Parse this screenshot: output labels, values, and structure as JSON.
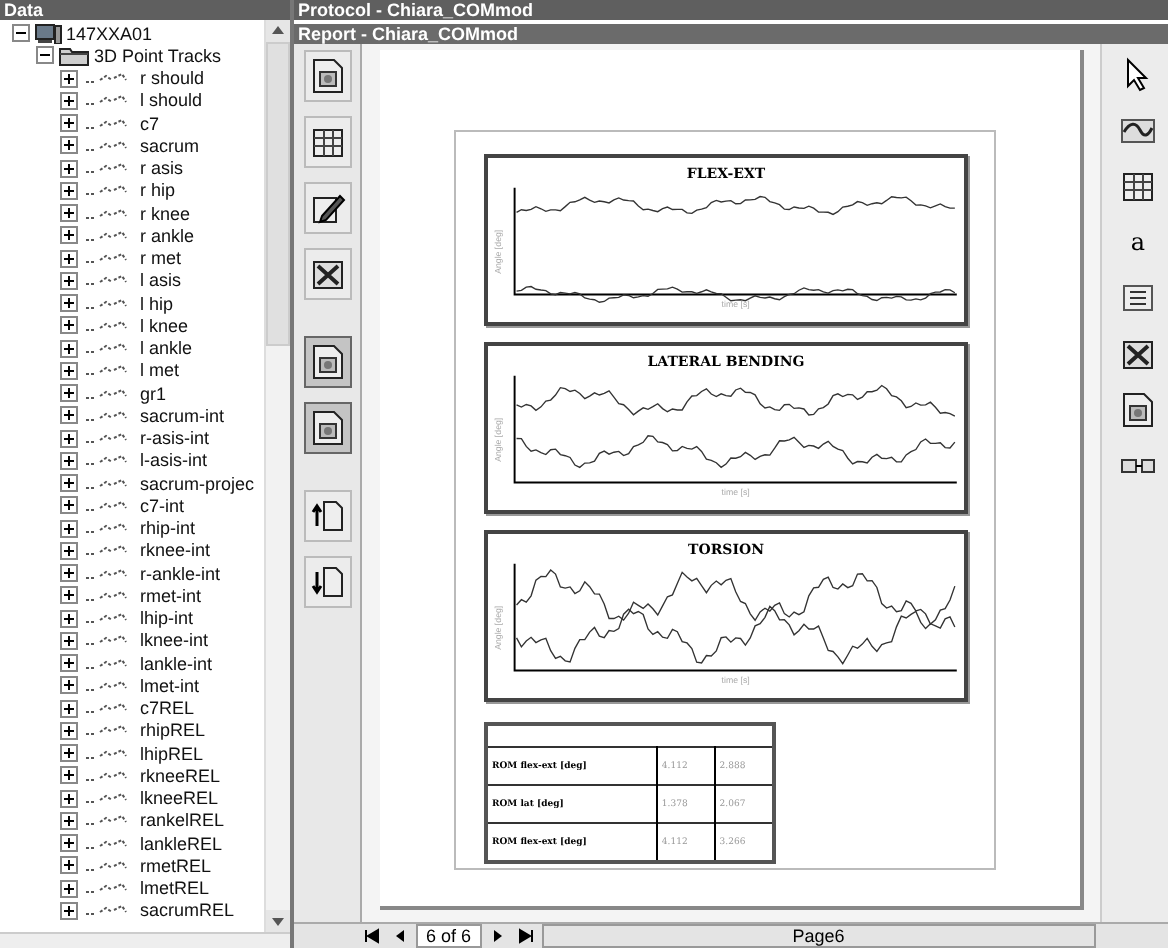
{
  "data_panel": {
    "title": "Data",
    "tree": [
      {
        "label": "147XXA01",
        "kind": "subject",
        "expanded": true,
        "children": [
          {
            "label": "3D Point Tracks",
            "kind": "folder",
            "expanded": true,
            "children": [
              {
                "label": "r should",
                "kind": "marker",
                "expanded": false
              },
              {
                "label": "l should",
                "kind": "marker",
                "expanded": false
              },
              {
                "label": "c7",
                "kind": "marker",
                "expanded": false
              },
              {
                "label": "sacrum",
                "kind": "marker",
                "expanded": false
              },
              {
                "label": "r asis",
                "kind": "marker",
                "expanded": false
              },
              {
                "label": "r hip",
                "kind": "marker",
                "expanded": false
              },
              {
                "label": "r knee",
                "kind": "marker",
                "expanded": false
              },
              {
                "label": "r ankle",
                "kind": "marker",
                "expanded": false
              },
              {
                "label": "r met",
                "kind": "marker",
                "expanded": false
              },
              {
                "label": "l asis",
                "kind": "marker",
                "expanded": false
              },
              {
                "label": "l hip",
                "kind": "marker",
                "expanded": false
              },
              {
                "label": "l knee",
                "kind": "marker",
                "expanded": false
              },
              {
                "label": "l ankle",
                "kind": "marker",
                "expanded": false
              },
              {
                "label": "l met",
                "kind": "marker",
                "expanded": false
              },
              {
                "label": "gr1",
                "kind": "marker",
                "expanded": false
              },
              {
                "label": "sacrum-int",
                "kind": "marker",
                "expanded": false
              },
              {
                "label": "r-asis-int",
                "kind": "marker",
                "expanded": false
              },
              {
                "label": "l-asis-int",
                "kind": "marker",
                "expanded": false
              },
              {
                "label": "sacrum-projec",
                "kind": "marker",
                "expanded": false
              },
              {
                "label": "c7-int",
                "kind": "marker",
                "expanded": false
              },
              {
                "label": "rhip-int",
                "kind": "marker",
                "expanded": false
              },
              {
                "label": "rknee-int",
                "kind": "marker",
                "expanded": false
              },
              {
                "label": "r-ankle-int",
                "kind": "marker",
                "expanded": false
              },
              {
                "label": "rmet-int",
                "kind": "marker",
                "expanded": false
              },
              {
                "label": "lhip-int",
                "kind": "marker",
                "expanded": false
              },
              {
                "label": "lknee-int",
                "kind": "marker",
                "expanded": false
              },
              {
                "label": "lankle-int",
                "kind": "marker",
                "expanded": false
              },
              {
                "label": "lmet-int",
                "kind": "marker",
                "expanded": false
              },
              {
                "label": "c7REL",
                "kind": "marker",
                "expanded": false
              },
              {
                "label": "rhipREL",
                "kind": "marker",
                "expanded": false
              },
              {
                "label": "lhipREL",
                "kind": "marker",
                "expanded": false
              },
              {
                "label": "rkneeREL",
                "kind": "marker",
                "expanded": false
              },
              {
                "label": "lkneeREL",
                "kind": "marker",
                "expanded": false
              },
              {
                "label": "rankelREL",
                "kind": "marker",
                "expanded": false
              },
              {
                "label": "lankleREL",
                "kind": "marker",
                "expanded": false
              },
              {
                "label": "rmetREL",
                "kind": "marker",
                "expanded": false
              },
              {
                "label": "lmetREL",
                "kind": "marker",
                "expanded": false
              },
              {
                "label": "sacrumREL",
                "kind": "marker",
                "expanded": false
              }
            ]
          }
        ]
      }
    ]
  },
  "protocol_title": "Protocol - Chiara_COMmod",
  "report_title": "Report - Chiara_COMmod",
  "left_toolbar": [
    {
      "kind": "image",
      "selected": false
    },
    {
      "kind": "table",
      "selected": false
    },
    {
      "kind": "pencil",
      "selected": false
    },
    {
      "kind": "delete",
      "selected": false
    },
    {
      "kind": "image",
      "selected": true
    },
    {
      "kind": "image",
      "selected": true
    },
    {
      "kind": "page-up",
      "selected": false
    },
    {
      "kind": "page-down",
      "selected": false
    }
  ],
  "report": {
    "charts": [
      {
        "title": "FLEX-EXT",
        "xlabel": "time [s]",
        "ylabel": "Angle [deg]"
      },
      {
        "title": "LATERAL BENDING",
        "xlabel": "time [s]",
        "ylabel": "Angle [deg]"
      },
      {
        "title": "TORSION",
        "xlabel": "time [s]",
        "ylabel": "Angle [deg]"
      }
    ],
    "table": {
      "rows": [
        [
          "ROM flex-ext [deg]",
          "4.112",
          "2.888"
        ],
        [
          "ROM lat [deg]",
          "1.378",
          "2.067"
        ],
        [
          "ROM flex-ext [deg]",
          "4.112",
          "3.266"
        ]
      ]
    }
  },
  "right_toolbar": [
    {
      "kind": "pointer"
    },
    {
      "kind": "wave"
    },
    {
      "kind": "table"
    },
    {
      "kind": "text",
      "label": "a"
    },
    {
      "kind": "list"
    },
    {
      "kind": "delete"
    },
    {
      "kind": "image"
    },
    {
      "kind": "link"
    }
  ],
  "pager": {
    "position": "6 of 6",
    "page": "Page6"
  }
}
